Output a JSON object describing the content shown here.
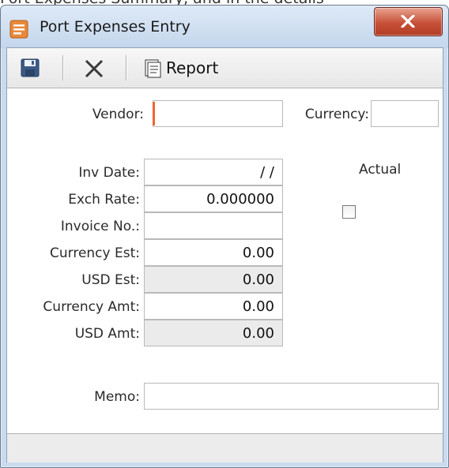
{
  "background": {
    "partial_text": "Port Expenses Summary, and in the details"
  },
  "window": {
    "title": "Port Expenses Entry",
    "icon": "port-expenses-app-icon",
    "close_icon": "close-x-icon"
  },
  "toolbar": {
    "save_icon": "floppy-disk-icon",
    "delete_icon": "x-delete-icon",
    "report_icon": "report-document-icon",
    "report_label": "Report"
  },
  "form": {
    "vendor": {
      "label": "Vendor:",
      "value": ""
    },
    "currency": {
      "label": "Currency:",
      "value": ""
    },
    "inv_date": {
      "label": "Inv Date:",
      "value": "/ /"
    },
    "actual": {
      "label": "Actual",
      "checked": false
    },
    "exch_rate": {
      "label": "Exch Rate:",
      "value": "0.000000"
    },
    "invoice_no": {
      "label": "Invoice No.:",
      "value": ""
    },
    "currency_est": {
      "label": "Currency Est:",
      "value": "0.00"
    },
    "usd_est": {
      "label": "USD Est:",
      "value": "0.00"
    },
    "currency_amt": {
      "label": "Currency Amt:",
      "value": "0.00"
    },
    "usd_amt": {
      "label": "USD Amt:",
      "value": "0.00"
    },
    "memo": {
      "label": "Memo:",
      "value": ""
    }
  },
  "colors": {
    "required_indicator": "#f0652f",
    "close_button": "#c75138",
    "readonly_field": "#ebebeb"
  }
}
